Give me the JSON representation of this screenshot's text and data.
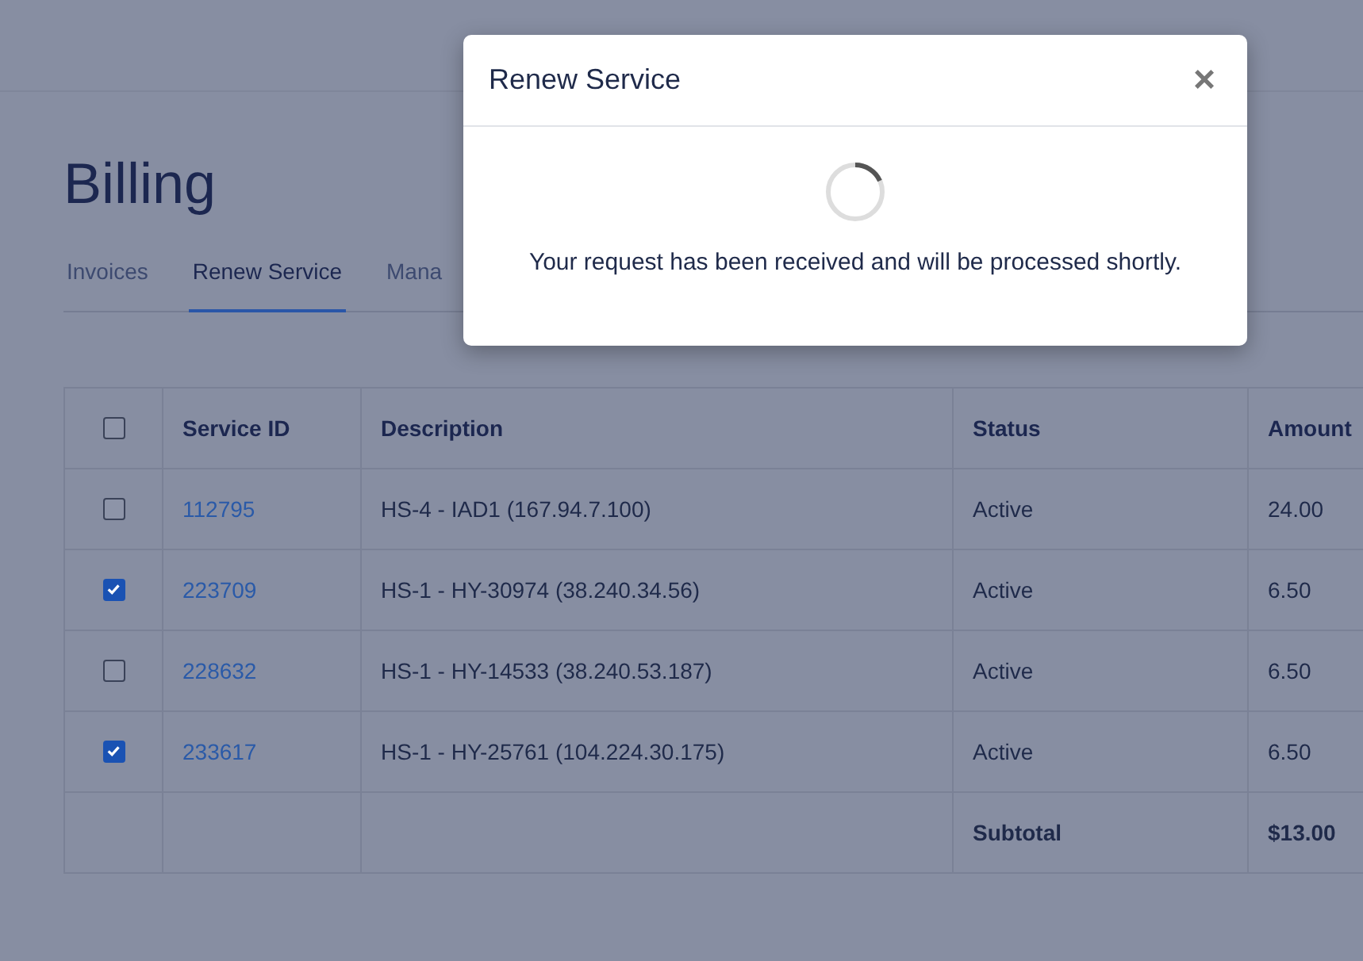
{
  "page": {
    "title": "Billing"
  },
  "tabs": [
    {
      "label": "Invoices",
      "selected": false
    },
    {
      "label": "Renew Service",
      "selected": true
    },
    {
      "label": "Mana",
      "selected": false
    }
  ],
  "table": {
    "select_all": {
      "checked": false
    },
    "columns": [
      "Service ID",
      "Description",
      "Status",
      "Amount"
    ],
    "rows": [
      {
        "checked": false,
        "service_id": "112795",
        "description": "HS-4 - IAD1 (167.94.7.100)",
        "status": "Active",
        "amount": "24.00"
      },
      {
        "checked": true,
        "service_id": "223709",
        "description": "HS-1 - HY-30974 (38.240.34.56)",
        "status": "Active",
        "amount": "6.50"
      },
      {
        "checked": false,
        "service_id": "228632",
        "description": "HS-1 - HY-14533 (38.240.53.187)",
        "status": "Active",
        "amount": "6.50"
      },
      {
        "checked": true,
        "service_id": "233617",
        "description": "HS-1 - HY-25761 (104.224.30.175)",
        "status": "Active",
        "amount": "6.50"
      }
    ],
    "subtotal": {
      "label": "Subtotal",
      "value": "$13.00"
    }
  },
  "modal": {
    "title": "Renew Service",
    "close": "×",
    "loading": true,
    "message": "Your request has been received and will be processed shortly."
  }
}
